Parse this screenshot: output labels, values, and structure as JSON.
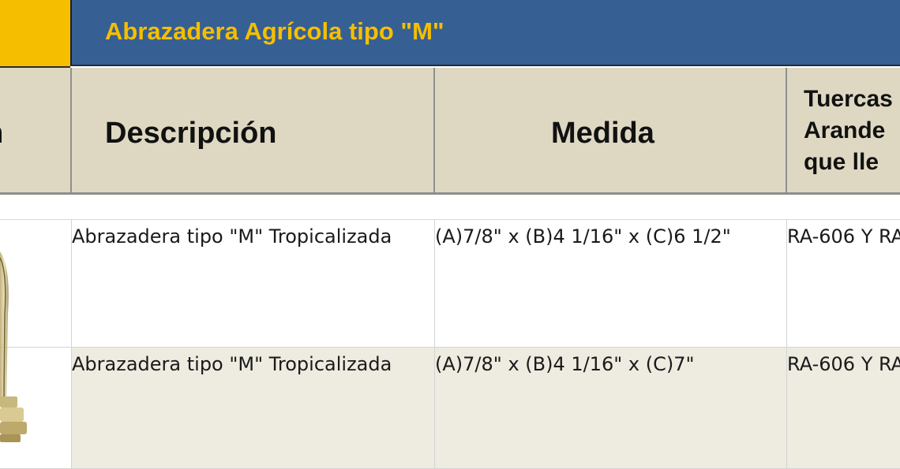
{
  "title": {
    "text": "Abrazadera Agrícola tipo \"M\""
  },
  "colors": {
    "title_bar": "#365f94",
    "title_accent": "#f5bf00",
    "header_bg": "#ded8c3",
    "alt_row_bg": "#eeebe0"
  },
  "table": {
    "headers": {
      "imagen": "en",
      "descripcion": "Descripción",
      "medida": "Medida",
      "tuercas": "Tuercas\nArande\nque lle"
    },
    "rows": [
      {
        "descripcion": "Abrazadera tipo \"M\" Tropicalizada",
        "medida": "(A)7/8\" x (B)4 1/16\" x (C)6 1/2\"",
        "tuercas": "RA-606 Y RA"
      },
      {
        "descripcion": "Abrazadera tipo \"M\" Tropicalizada",
        "medida": "(A)7/8\" x (B)4 1/16\" x (C)7\"",
        "tuercas": "RA-606 Y RA"
      }
    ]
  }
}
